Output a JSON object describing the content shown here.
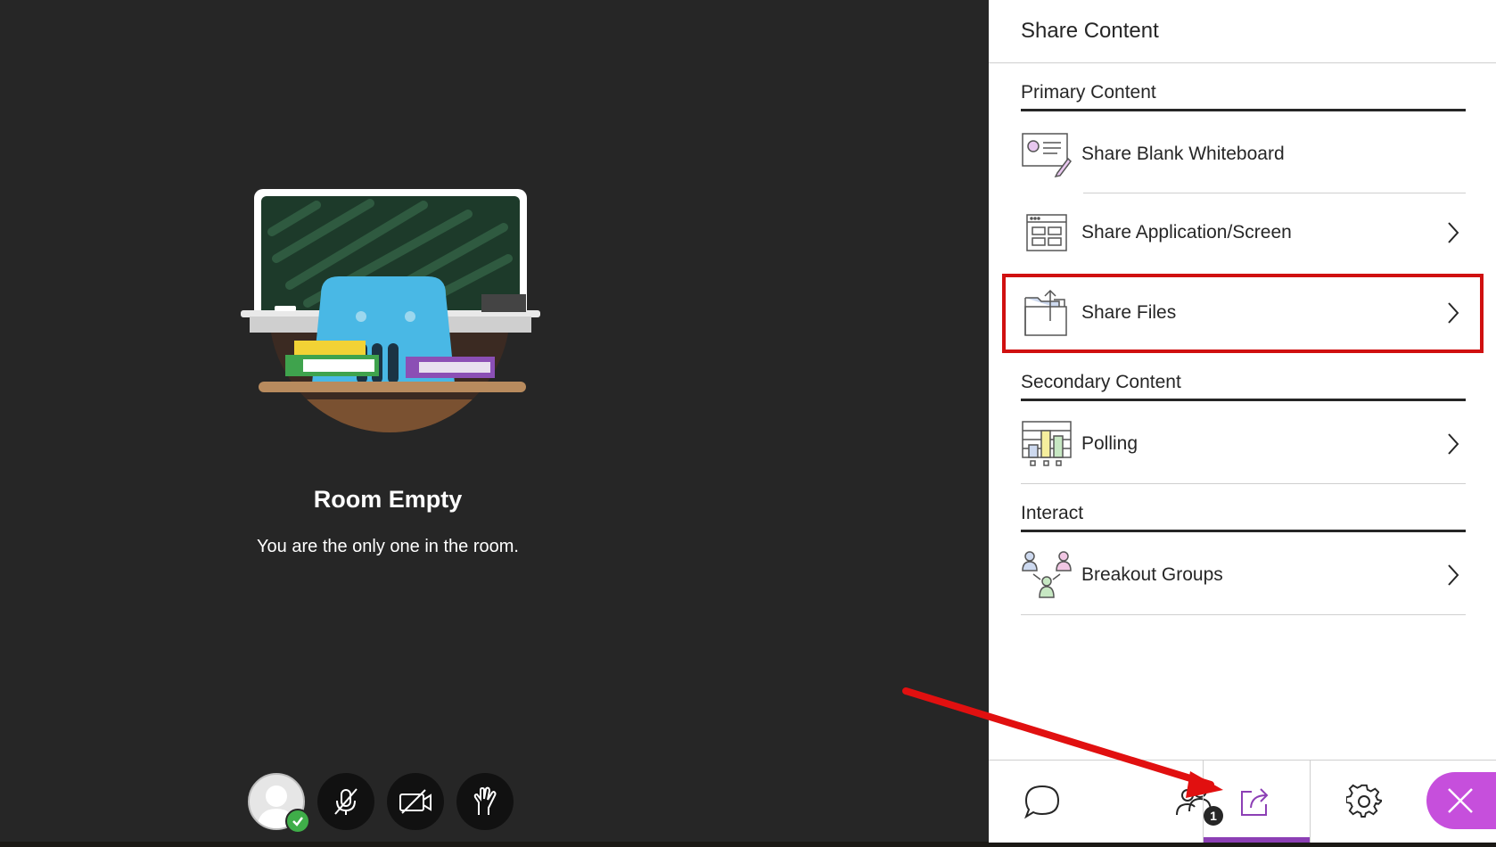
{
  "stage": {
    "room_title": "Room Empty",
    "room_subtitle": "You are the only one in the room."
  },
  "controls": [
    {
      "name": "my-avatar",
      "icon": "user-avatar-icon"
    },
    {
      "name": "microphone-toggle",
      "icon": "microphone-off-icon"
    },
    {
      "name": "camera-toggle",
      "icon": "camera-off-icon"
    },
    {
      "name": "raise-hand",
      "icon": "hand-icon"
    }
  ],
  "panel": {
    "title": "Share Content",
    "primary_heading": "Primary Content",
    "primary_items": [
      {
        "label": "Share Blank Whiteboard",
        "icon": "whiteboard-icon"
      },
      {
        "label": "Share Application/Screen",
        "icon": "screen-share-icon"
      },
      {
        "label": "Share Files",
        "icon": "file-upload-icon"
      }
    ],
    "secondary_heading": "Secondary Content",
    "secondary_items": [
      {
        "label": "Polling",
        "icon": "poll-chart-icon"
      }
    ],
    "interact_heading": "Interact",
    "interact_items": [
      {
        "label": "Breakout Groups",
        "icon": "breakout-groups-icon"
      }
    ]
  },
  "tabbar": {
    "tabs": [
      {
        "name": "chat",
        "icon": "chat-bubble-icon"
      },
      {
        "name": "attendees",
        "icon": "attendees-icon",
        "badge": "1"
      },
      {
        "name": "share-content",
        "icon": "share-icon",
        "active": true
      },
      {
        "name": "settings",
        "icon": "gear-icon"
      }
    ],
    "close_icon": "close-icon"
  },
  "colors": {
    "accent": "#8c3fb5",
    "close_bg": "#c64fdc",
    "highlight": "#d01010",
    "stage_bg": "#262626"
  }
}
